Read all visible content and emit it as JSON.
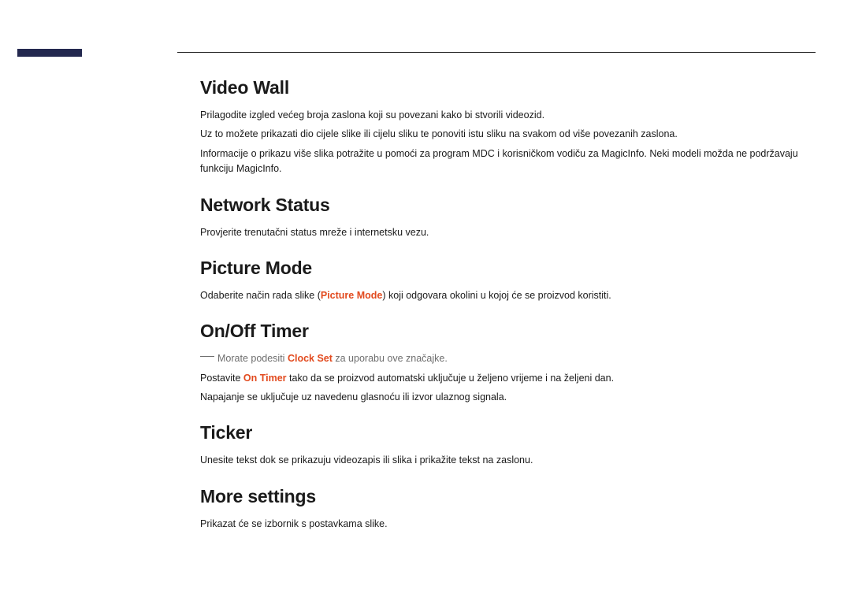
{
  "sections": {
    "videoWall": {
      "title": "Video Wall",
      "p1": "Prilagodite izgled većeg broja zaslona koji su povezani kako bi stvorili videozid.",
      "p2": "Uz to možete prikazati dio cijele slike ili cijelu sliku te ponoviti istu sliku na svakom od više povezanih zaslona.",
      "p3": "Informacije o prikazu više slika potražite u pomoći za program MDC i korisničkom vodiču za MagicInfo. Neki modeli možda ne podržavaju funkciju MagicInfo."
    },
    "networkStatus": {
      "title": "Network Status",
      "p1": "Provjerite trenutačni status mreže i internetsku vezu."
    },
    "pictureMode": {
      "title": "Picture Mode",
      "p1a": "Odaberite način rada slike (",
      "p1hl": "Picture Mode",
      "p1b": ") koji odgovara okolini u kojoj će se proizvod koristiti."
    },
    "onOffTimer": {
      "title": "On/Off Timer",
      "note_a": "Morate podesiti ",
      "note_hl": "Clock Set",
      "note_b": " za uporabu ove značajke.",
      "p2a": "Postavite ",
      "p2hl": "On Timer",
      "p2b": " tako da se proizvod automatski uključuje u željeno vrijeme i na željeni dan.",
      "p3": "Napajanje se uključuje uz navedenu glasnoću ili izvor ulaznog signala."
    },
    "ticker": {
      "title": "Ticker",
      "p1": "Unesite tekst dok se prikazuju videozapis ili slika i prikažite tekst na zaslonu."
    },
    "moreSettings": {
      "title": "More settings",
      "p1": "Prikazat će se izbornik s postavkama slike."
    }
  }
}
